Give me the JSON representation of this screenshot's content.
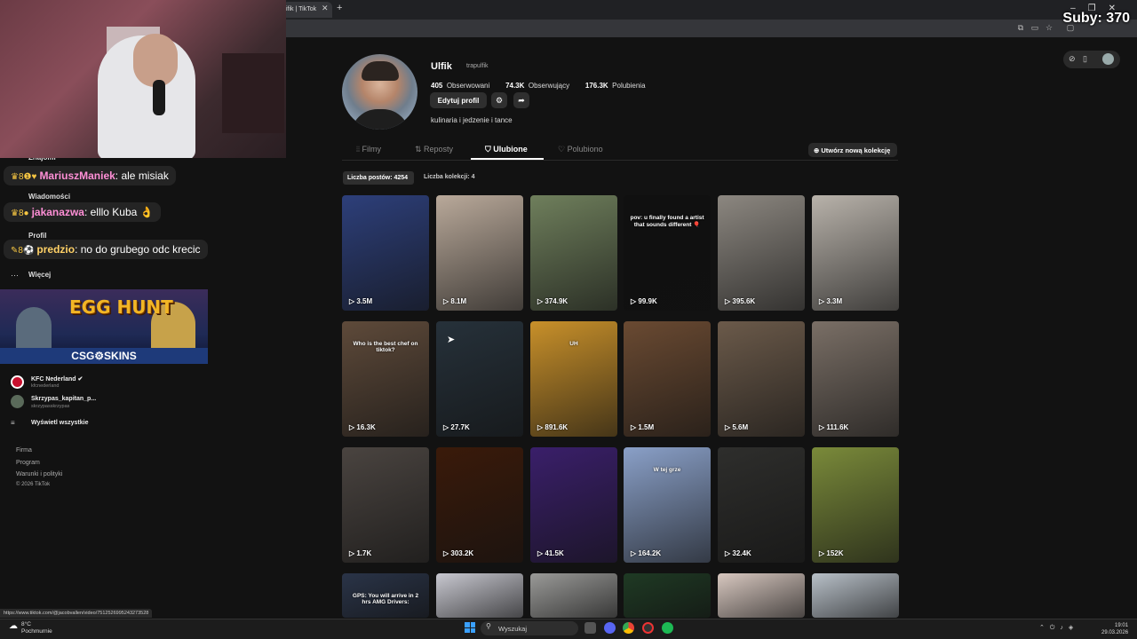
{
  "browser": {
    "tab_title": "ifik | TikTok",
    "tab_close": "✕",
    "new_tab": "+",
    "window_controls": "–❐✕"
  },
  "overlay": {
    "subs_label": "Suby: 370",
    "chat": [
      {
        "user": "MariuszManiek",
        "text": ": ale misiak",
        "color": "#ff8fd6",
        "badges": "♛8❶♥"
      },
      {
        "user": "jakanazwa",
        "text": ": elllo Kuba 👌",
        "color": "#ff8fd6",
        "badges": "♛8●"
      },
      {
        "user": "predzio",
        "text": ": no do grubego odc krecic",
        "color": "#ffd166",
        "badges": "✎8⚽"
      }
    ],
    "promo_title": "EGG HUNT",
    "promo_brand": "CSG⚙SKINS"
  },
  "sidebar": {
    "nav": [
      "Znajomi",
      "Wiadomości",
      "Profil",
      "Więcej"
    ],
    "more_icon": "⋯",
    "accounts": [
      {
        "name": "KFC Nederland ✔",
        "handle": "kfcnederland"
      },
      {
        "name": "Skrzypas_kapitan_p...",
        "handle": "skrzypasskrzypas"
      }
    ],
    "see_all": "Wyświetl wszystkie",
    "footer": [
      "Firma",
      "Program",
      "Warunki i polityki",
      "© 2026 TikTok"
    ]
  },
  "profile": {
    "username": "Ulfik",
    "handle": "trapulfik",
    "following_n": "405",
    "following_l": "Obserwowani",
    "followers_n": "74.3K",
    "followers_l": "Obserwujący",
    "likes_n": "176.3K",
    "likes_l": "Polubienia",
    "edit_label": "Edytuj profil",
    "settings_icon": "⚙",
    "share_icon": "➦",
    "bio": "kulinaria i jedzenie i tance"
  },
  "tabs": [
    "⦙⦙ Filmy",
    "⇅ Reposty",
    "⛉ Ulubione",
    "♡ Polubiono"
  ],
  "new_collection": "⊕ Utwórz nową kolekcję",
  "counts": {
    "posts": "Liczba postów: 4254",
    "collections": "Liczba kolekcji: 4"
  },
  "videos": [
    {
      "views": "▷ 3.5M",
      "caption": "",
      "color": "#2d3f7a"
    },
    {
      "views": "▷ 8.1M",
      "caption": "",
      "color": "#b9a99a"
    },
    {
      "views": "▷ 374.9K",
      "caption": "",
      "color": "#6f7f5c"
    },
    {
      "views": "▷ 99.9K",
      "caption": "pov: u finally found a artist that sounds different 🎈",
      "color": "#101010"
    },
    {
      "views": "▷ 395.6K",
      "caption": "",
      "color": "#8c8780"
    },
    {
      "views": "▷ 3.3M",
      "caption": "",
      "color": "#b8b2aa"
    },
    {
      "views": "▷ 16.3K",
      "caption": "Who is the best chef on tiktok?",
      "color": "#5e4a3a"
    },
    {
      "views": "▷ 27.7K",
      "caption": "",
      "color": "#26313a"
    },
    {
      "views": "▷ 891.6K",
      "caption": "UH",
      "color": "#c8902a"
    },
    {
      "views": "▷ 1.5M",
      "caption": "",
      "color": "#6a4a32"
    },
    {
      "views": "▷ 5.6M",
      "caption": "",
      "color": "#6b5a4a"
    },
    {
      "views": "▷ 111.6K",
      "caption": "",
      "color": "#7a6f66"
    },
    {
      "views": "▷ 1.7K",
      "caption": "",
      "color": "#4a4440"
    },
    {
      "views": "▷ 303.2K",
      "caption": "",
      "color": "#3a1a0a"
    },
    {
      "views": "▷ 41.5K",
      "caption": "",
      "color": "#3a1f6a"
    },
    {
      "views": "▷ 164.2K",
      "caption": "W tej grze",
      "color": "#8aa0c8"
    },
    {
      "views": "▷ 32.4K",
      "caption": "",
      "color": "#2e2e2c"
    },
    {
      "views": "▷ 152K",
      "caption": "",
      "color": "#7a8a3a"
    },
    {
      "views": "",
      "caption": "GPS: You will arrive in 2 hrs  AMG Drivers:",
      "color": "#2a3448"
    },
    {
      "views": "",
      "caption": "",
      "color": "#c8c8d0"
    },
    {
      "views": "",
      "caption": "",
      "color": "#9a9a98"
    },
    {
      "views": "",
      "caption": "",
      "color": "#1f3a24"
    },
    {
      "views": "",
      "caption": "",
      "color": "#d8c8c0"
    },
    {
      "views": "",
      "caption": "",
      "color": "#b8c0c8"
    }
  ],
  "status_url": "https://www.tiktok.com/@jacobvallen/video/7512526995243273528",
  "taskbar": {
    "temp": "8°C",
    "weather": "Pochmurnie",
    "search": "Wyszukaj",
    "time": "19:01",
    "date": "29.03.2026"
  }
}
